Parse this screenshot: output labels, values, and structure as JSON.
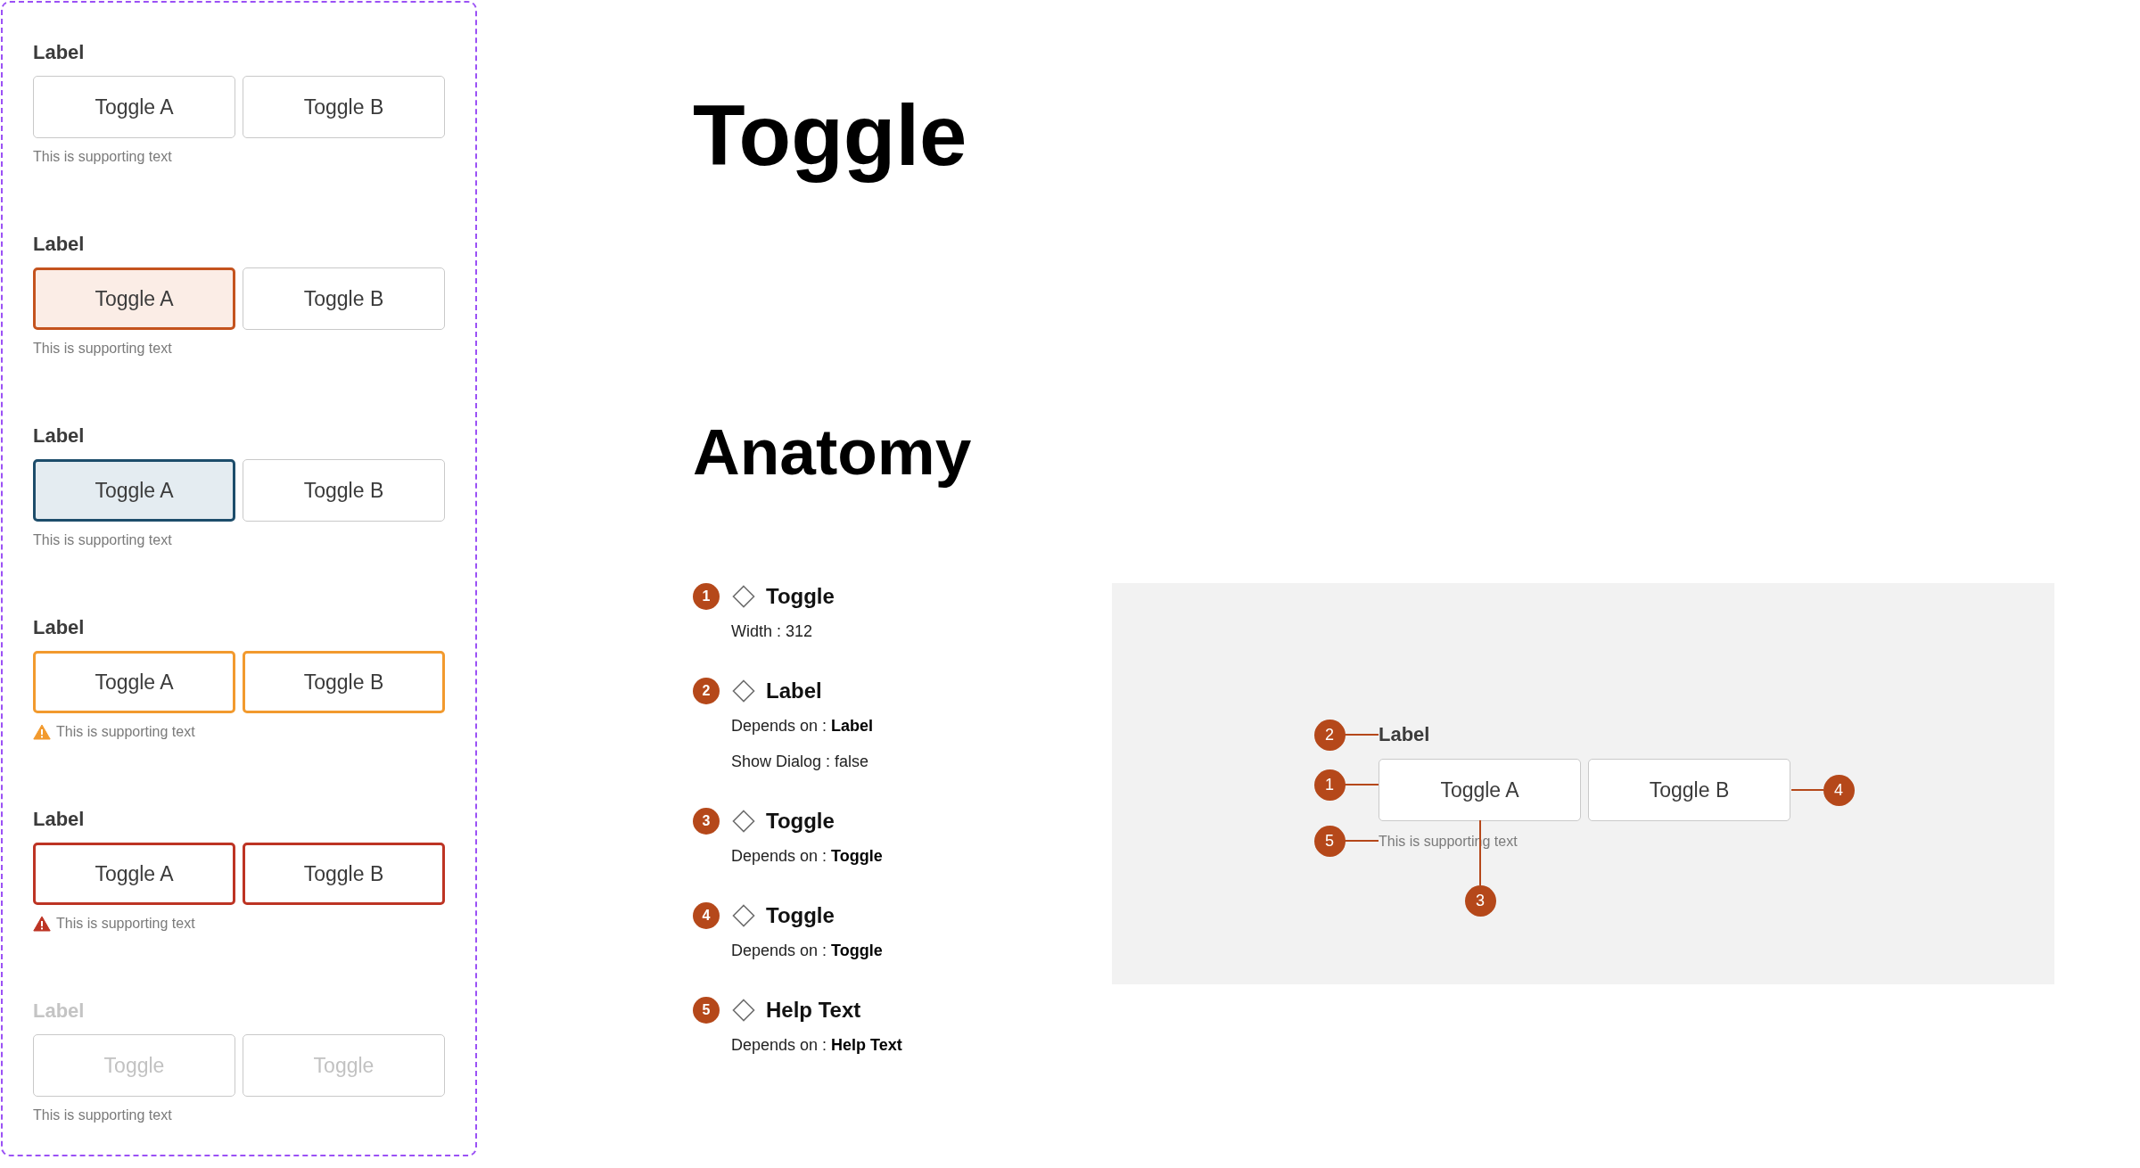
{
  "variant_panel": {
    "variants": [
      {
        "label": "Label",
        "disabled": false,
        "kind": "default",
        "toggles": [
          {
            "text": "Toggle A",
            "selected": false,
            "focused": false
          },
          {
            "text": "Toggle B",
            "selected": false,
            "focused": false
          }
        ],
        "supporting_text": "This is supporting text"
      },
      {
        "label": "Label",
        "disabled": false,
        "kind": "default",
        "toggles": [
          {
            "text": "Toggle A",
            "selected": true,
            "focused": false
          },
          {
            "text": "Toggle B",
            "selected": false,
            "focused": false
          }
        ],
        "supporting_text": "This is supporting text"
      },
      {
        "label": "Label",
        "disabled": false,
        "kind": "default",
        "toggles": [
          {
            "text": "Toggle A",
            "selected": false,
            "focused": true
          },
          {
            "text": "Toggle B",
            "selected": false,
            "focused": false
          }
        ],
        "supporting_text": "This is supporting text"
      },
      {
        "label": "Label",
        "disabled": false,
        "kind": "warning",
        "toggles": [
          {
            "text": "Toggle A",
            "selected": false,
            "focused": false
          },
          {
            "text": "Toggle B",
            "selected": false,
            "focused": false
          }
        ],
        "supporting_text": "This is supporting text"
      },
      {
        "label": "Label",
        "disabled": false,
        "kind": "error",
        "toggles": [
          {
            "text": "Toggle A",
            "selected": false,
            "focused": false
          },
          {
            "text": "Toggle B",
            "selected": false,
            "focused": false
          }
        ],
        "supporting_text": "This is supporting text"
      },
      {
        "label": "Label",
        "disabled": true,
        "kind": "default",
        "toggles": [
          {
            "text": "Toggle",
            "selected": false,
            "focused": false
          },
          {
            "text": "Toggle",
            "selected": false,
            "focused": false
          }
        ],
        "supporting_text": "This is supporting text"
      }
    ]
  },
  "page_title": "Toggle",
  "anatomy": {
    "heading": "Anatomy",
    "parts": [
      {
        "number": "1",
        "title": "Toggle",
        "properties": [
          "Width : 312"
        ]
      },
      {
        "number": "2",
        "title": "Label",
        "properties": [
          "Depends on : **Label**",
          "Show Dialog : false"
        ]
      },
      {
        "number": "3",
        "title": "Toggle",
        "properties": [
          "Depends on : **Toggle**"
        ]
      },
      {
        "number": "4",
        "title": "Toggle",
        "properties": [
          "Depends on : **Toggle**"
        ]
      },
      {
        "number": "5",
        "title": "Help Text",
        "properties": [
          "Depends on : **Help Text**"
        ]
      }
    ],
    "diagram": {
      "label": "Label",
      "toggles": [
        {
          "text": "Toggle A"
        },
        {
          "text": "Toggle B"
        }
      ],
      "supporting_text": "This is supporting text",
      "callouts": [
        {
          "number": "2",
          "kind": "label"
        },
        {
          "number": "1",
          "kind": "left"
        },
        {
          "number": "4",
          "kind": "right"
        },
        {
          "number": "5",
          "kind": "help"
        },
        {
          "number": "3",
          "kind": "bottom"
        }
      ]
    }
  }
}
